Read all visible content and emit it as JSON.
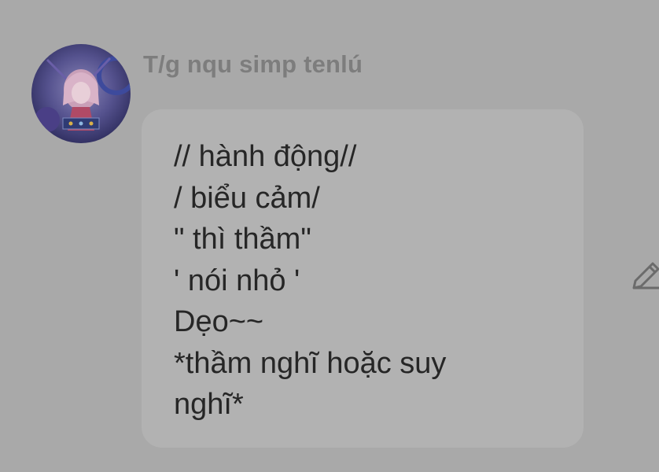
{
  "message": {
    "sender_name": "T/g nqu simp tenlú",
    "avatar_icon": "anime-character-avatar",
    "lines": [
      "// hành động//",
      "/ biểu cảm/",
      "\" thì thầm\"",
      "' nói nhỏ '",
      "Dẹo~~",
      "*thầm nghĩ hoặc suy",
      "nghĩ*"
    ],
    "edit_icon": "pencil-icon"
  },
  "colors": {
    "background": "#a9a9a9",
    "bubble": "#b2b2b2",
    "sender_name": "#7d7d7d",
    "message_text": "#262626",
    "icon": "#6b6b6b"
  }
}
